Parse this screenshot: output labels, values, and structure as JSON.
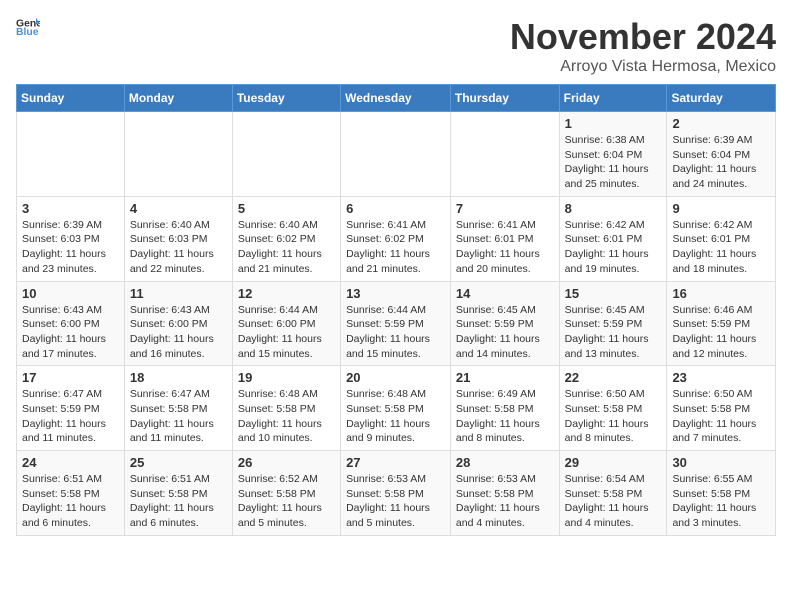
{
  "header": {
    "logo_general": "General",
    "logo_blue": "Blue",
    "month": "November 2024",
    "location": "Arroyo Vista Hermosa, Mexico"
  },
  "weekdays": [
    "Sunday",
    "Monday",
    "Tuesday",
    "Wednesday",
    "Thursday",
    "Friday",
    "Saturday"
  ],
  "weeks": [
    [
      {
        "day": "",
        "detail": ""
      },
      {
        "day": "",
        "detail": ""
      },
      {
        "day": "",
        "detail": ""
      },
      {
        "day": "",
        "detail": ""
      },
      {
        "day": "",
        "detail": ""
      },
      {
        "day": "1",
        "detail": "Sunrise: 6:38 AM\nSunset: 6:04 PM\nDaylight: 11 hours\nand 25 minutes."
      },
      {
        "day": "2",
        "detail": "Sunrise: 6:39 AM\nSunset: 6:04 PM\nDaylight: 11 hours\nand 24 minutes."
      }
    ],
    [
      {
        "day": "3",
        "detail": "Sunrise: 6:39 AM\nSunset: 6:03 PM\nDaylight: 11 hours\nand 23 minutes."
      },
      {
        "day": "4",
        "detail": "Sunrise: 6:40 AM\nSunset: 6:03 PM\nDaylight: 11 hours\nand 22 minutes."
      },
      {
        "day": "5",
        "detail": "Sunrise: 6:40 AM\nSunset: 6:02 PM\nDaylight: 11 hours\nand 21 minutes."
      },
      {
        "day": "6",
        "detail": "Sunrise: 6:41 AM\nSunset: 6:02 PM\nDaylight: 11 hours\nand 21 minutes."
      },
      {
        "day": "7",
        "detail": "Sunrise: 6:41 AM\nSunset: 6:01 PM\nDaylight: 11 hours\nand 20 minutes."
      },
      {
        "day": "8",
        "detail": "Sunrise: 6:42 AM\nSunset: 6:01 PM\nDaylight: 11 hours\nand 19 minutes."
      },
      {
        "day": "9",
        "detail": "Sunrise: 6:42 AM\nSunset: 6:01 PM\nDaylight: 11 hours\nand 18 minutes."
      }
    ],
    [
      {
        "day": "10",
        "detail": "Sunrise: 6:43 AM\nSunset: 6:00 PM\nDaylight: 11 hours\nand 17 minutes."
      },
      {
        "day": "11",
        "detail": "Sunrise: 6:43 AM\nSunset: 6:00 PM\nDaylight: 11 hours\nand 16 minutes."
      },
      {
        "day": "12",
        "detail": "Sunrise: 6:44 AM\nSunset: 6:00 PM\nDaylight: 11 hours\nand 15 minutes."
      },
      {
        "day": "13",
        "detail": "Sunrise: 6:44 AM\nSunset: 5:59 PM\nDaylight: 11 hours\nand 15 minutes."
      },
      {
        "day": "14",
        "detail": "Sunrise: 6:45 AM\nSunset: 5:59 PM\nDaylight: 11 hours\nand 14 minutes."
      },
      {
        "day": "15",
        "detail": "Sunrise: 6:45 AM\nSunset: 5:59 PM\nDaylight: 11 hours\nand 13 minutes."
      },
      {
        "day": "16",
        "detail": "Sunrise: 6:46 AM\nSunset: 5:59 PM\nDaylight: 11 hours\nand 12 minutes."
      }
    ],
    [
      {
        "day": "17",
        "detail": "Sunrise: 6:47 AM\nSunset: 5:59 PM\nDaylight: 11 hours\nand 11 minutes."
      },
      {
        "day": "18",
        "detail": "Sunrise: 6:47 AM\nSunset: 5:58 PM\nDaylight: 11 hours\nand 11 minutes."
      },
      {
        "day": "19",
        "detail": "Sunrise: 6:48 AM\nSunset: 5:58 PM\nDaylight: 11 hours\nand 10 minutes."
      },
      {
        "day": "20",
        "detail": "Sunrise: 6:48 AM\nSunset: 5:58 PM\nDaylight: 11 hours\nand 9 minutes."
      },
      {
        "day": "21",
        "detail": "Sunrise: 6:49 AM\nSunset: 5:58 PM\nDaylight: 11 hours\nand 8 minutes."
      },
      {
        "day": "22",
        "detail": "Sunrise: 6:50 AM\nSunset: 5:58 PM\nDaylight: 11 hours\nand 8 minutes."
      },
      {
        "day": "23",
        "detail": "Sunrise: 6:50 AM\nSunset: 5:58 PM\nDaylight: 11 hours\nand 7 minutes."
      }
    ],
    [
      {
        "day": "24",
        "detail": "Sunrise: 6:51 AM\nSunset: 5:58 PM\nDaylight: 11 hours\nand 6 minutes."
      },
      {
        "day": "25",
        "detail": "Sunrise: 6:51 AM\nSunset: 5:58 PM\nDaylight: 11 hours\nand 6 minutes."
      },
      {
        "day": "26",
        "detail": "Sunrise: 6:52 AM\nSunset: 5:58 PM\nDaylight: 11 hours\nand 5 minutes."
      },
      {
        "day": "27",
        "detail": "Sunrise: 6:53 AM\nSunset: 5:58 PM\nDaylight: 11 hours\nand 5 minutes."
      },
      {
        "day": "28",
        "detail": "Sunrise: 6:53 AM\nSunset: 5:58 PM\nDaylight: 11 hours\nand 4 minutes."
      },
      {
        "day": "29",
        "detail": "Sunrise: 6:54 AM\nSunset: 5:58 PM\nDaylight: 11 hours\nand 4 minutes."
      },
      {
        "day": "30",
        "detail": "Sunrise: 6:55 AM\nSunset: 5:58 PM\nDaylight: 11 hours\nand 3 minutes."
      }
    ]
  ]
}
